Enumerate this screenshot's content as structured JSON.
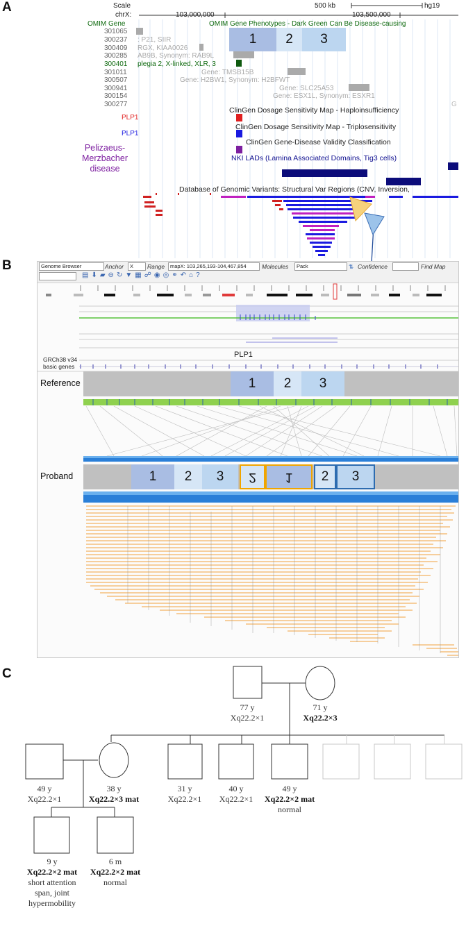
{
  "panels": {
    "a": "A",
    "b": "B",
    "c": "C"
  },
  "ucsc": {
    "scale_label": "Scale",
    "scale_value": "500 kb",
    "assembly": "hg19",
    "chrom_label": "chrX:",
    "pos1": "103,000,000",
    "pos2": "103,500,000",
    "omim_gene_label": "OMIM Gene",
    "omim_pheno_title": "OMIM Gene Phenotypes - Dark Green Can Be Disease-causing",
    "omim_rows": [
      {
        "id": "301065",
        "text": ""
      },
      {
        "id": "300237",
        "text": ": P21, SIIR"
      },
      {
        "id": "300409",
        "text": "RGX, KIAA0026"
      },
      {
        "id": "300285",
        "text": "AB9B, Synonym: RAB9L"
      },
      {
        "id": "300401",
        "text": "plegia 2, X-linked, XLR, 3"
      },
      {
        "id": "301011",
        "text": "Gene: TMSB15B"
      },
      {
        "id": "300507",
        "text": "Gene: H2BW1, Synonym: H2BFWT"
      },
      {
        "id": "300941",
        "text": "Gene: SLC25A53"
      },
      {
        "id": "300154",
        "text": "Gene: ESX1L, Synonym: ESXR1"
      },
      {
        "id": "300277",
        "text": ""
      }
    ],
    "plp1_a": "PLP1",
    "plp1_b": "PLP1",
    "clingen_hi": "ClinGen Dosage Sensitivity Map - Haploinsufficiency",
    "clingen_ts": "ClinGen Dosage Sensitivity Map - Triplosensitivity",
    "clingen_gd": "ClinGen Gene-Disease Validity Classification",
    "disease_line1": "Pelizaeus-",
    "disease_line2": "Merzbacher",
    "disease_line3": "disease",
    "nki_lads": "NKI LADs (Lamina Associated Domains, Tig3 cells)",
    "dgv": "Database of Genomic Variants: Structural Var Regions (CNV, Inversion,",
    "edge_char": "G",
    "segments": [
      "1",
      "2",
      "3"
    ],
    "colors": {
      "seg1": "#a9bde3",
      "seg2": "#d6e6f6",
      "seg3": "#bcd6f0",
      "clinred": "#e02020",
      "clinblue": "#1a1ae0",
      "clinpurple": "#7d1fa0",
      "darkgreen": "#0f5a0f",
      "lad": "#0c0c7a"
    }
  },
  "browser": {
    "mode": "Genome Browser",
    "anchor_label": "Anchor",
    "anchor_value": "X",
    "range_label": "Range",
    "range_value": "mapX: 103,265,193-104,467,854",
    "molecules_label": "Molecules",
    "molecules_value": "Pack",
    "confidence_label": "Confidence",
    "find_map": "Find Map",
    "gene_label": "PLP1",
    "track_label_1": "GRCh38 v34",
    "track_label_2": "basic genes",
    "reference_label": "Reference",
    "proband_label": "Proband",
    "ref_segments": [
      "1",
      "2",
      "3"
    ],
    "proband_segments": [
      "1",
      "2",
      "3",
      "2",
      "1",
      "2",
      "3"
    ],
    "colors": {
      "orange_box": "#f0a500",
      "blue_box": "#2d6cb0",
      "molecule": "#f0a23c",
      "lime": "#8fd14f"
    }
  },
  "pedigree": {
    "grandfather": {
      "age": "77 y",
      "geno": "Xq22.2×1"
    },
    "grandmother": {
      "age": "71 y",
      "geno": "Xq22.2×3"
    },
    "p1": {
      "age": "49 y",
      "geno": "Xq22.2×1"
    },
    "p2": {
      "age": "38 y",
      "geno": "Xq22.2×3 mat"
    },
    "p3": {
      "age": "31 y",
      "geno": "Xq22.2×1"
    },
    "p4": {
      "age": "40 y",
      "geno": "Xq22.2×1"
    },
    "p5": {
      "age": "49 y",
      "geno": "Xq22.2×2 mat",
      "note": "normal"
    },
    "c1": {
      "age": "9 y",
      "geno": "Xq22.2×2 mat",
      "note1": "short attention",
      "note2": "span, joint",
      "note3": "hypermobility"
    },
    "c2": {
      "age": "6 m",
      "geno": "Xq22.2×2 mat",
      "note": "normal"
    }
  }
}
